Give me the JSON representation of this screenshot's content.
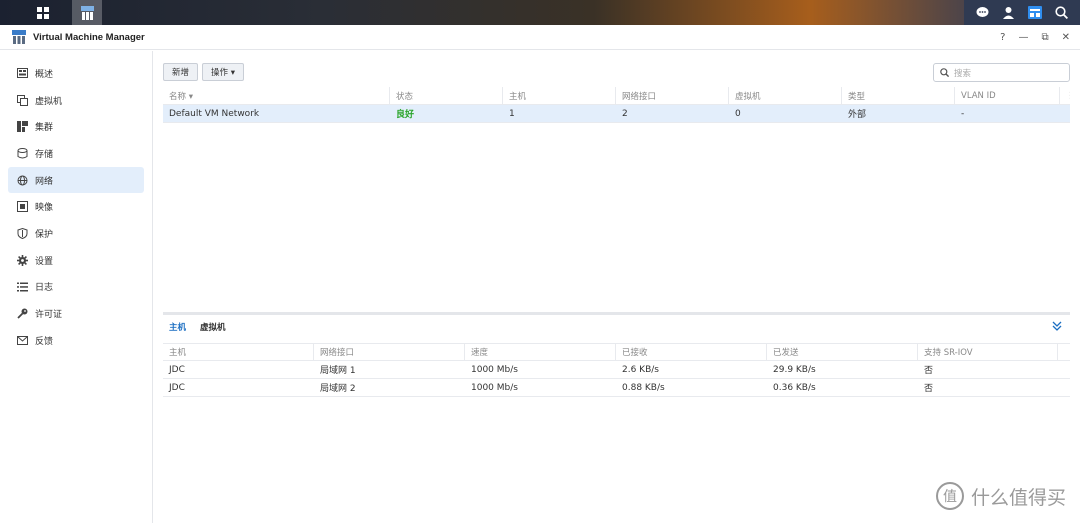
{
  "window": {
    "title": "Virtual Machine Manager",
    "controls": [
      "?",
      "—",
      "⧉",
      "✕"
    ]
  },
  "sidebar": {
    "items": [
      {
        "label": "概述",
        "icon": "overview-icon"
      },
      {
        "label": "虚拟机",
        "icon": "vm-icon"
      },
      {
        "label": "集群",
        "icon": "cluster-icon"
      },
      {
        "label": "存储",
        "icon": "storage-icon"
      },
      {
        "label": "网络",
        "icon": "network-icon",
        "active": true
      },
      {
        "label": "映像",
        "icon": "image-icon"
      },
      {
        "label": "保护",
        "icon": "shield-icon"
      },
      {
        "label": "设置",
        "icon": "gear-icon"
      },
      {
        "label": "日志",
        "icon": "log-icon"
      },
      {
        "label": "许可证",
        "icon": "key-icon"
      },
      {
        "label": "反馈",
        "icon": "mail-icon"
      }
    ]
  },
  "toolbar": {
    "add_label": "新增",
    "action_label": "操作 ▾"
  },
  "search": {
    "placeholder": "搜索"
  },
  "network_table": {
    "columns": [
      "名称 ▾",
      "状态",
      "主机",
      "网络接口",
      "虚拟机",
      "类型",
      "VLAN ID"
    ],
    "rows": [
      [
        "Default VM Network",
        "良好",
        "1",
        "2",
        "0",
        "外部",
        "-"
      ]
    ]
  },
  "detail_tabs": [
    "主机",
    "虚拟机"
  ],
  "host_table": {
    "columns": [
      "主机",
      "网络接口",
      "速度",
      "已接收",
      "已发送",
      "支持 SR-IOV"
    ],
    "rows": [
      [
        "JDC",
        "局域网 1",
        "1000 Mb/s",
        "2.6 KB/s",
        "29.9 KB/s",
        "否"
      ],
      [
        "JDC",
        "局域网 2",
        "1000 Mb/s",
        "0.88 KB/s",
        "0.36 KB/s",
        "否"
      ]
    ]
  },
  "watermark": {
    "text": "什么值得买",
    "badge": "值"
  },
  "colors": {
    "accent": "#1b6ec2",
    "status_ok": "#2aa52a",
    "selection": "#e3eefb"
  }
}
